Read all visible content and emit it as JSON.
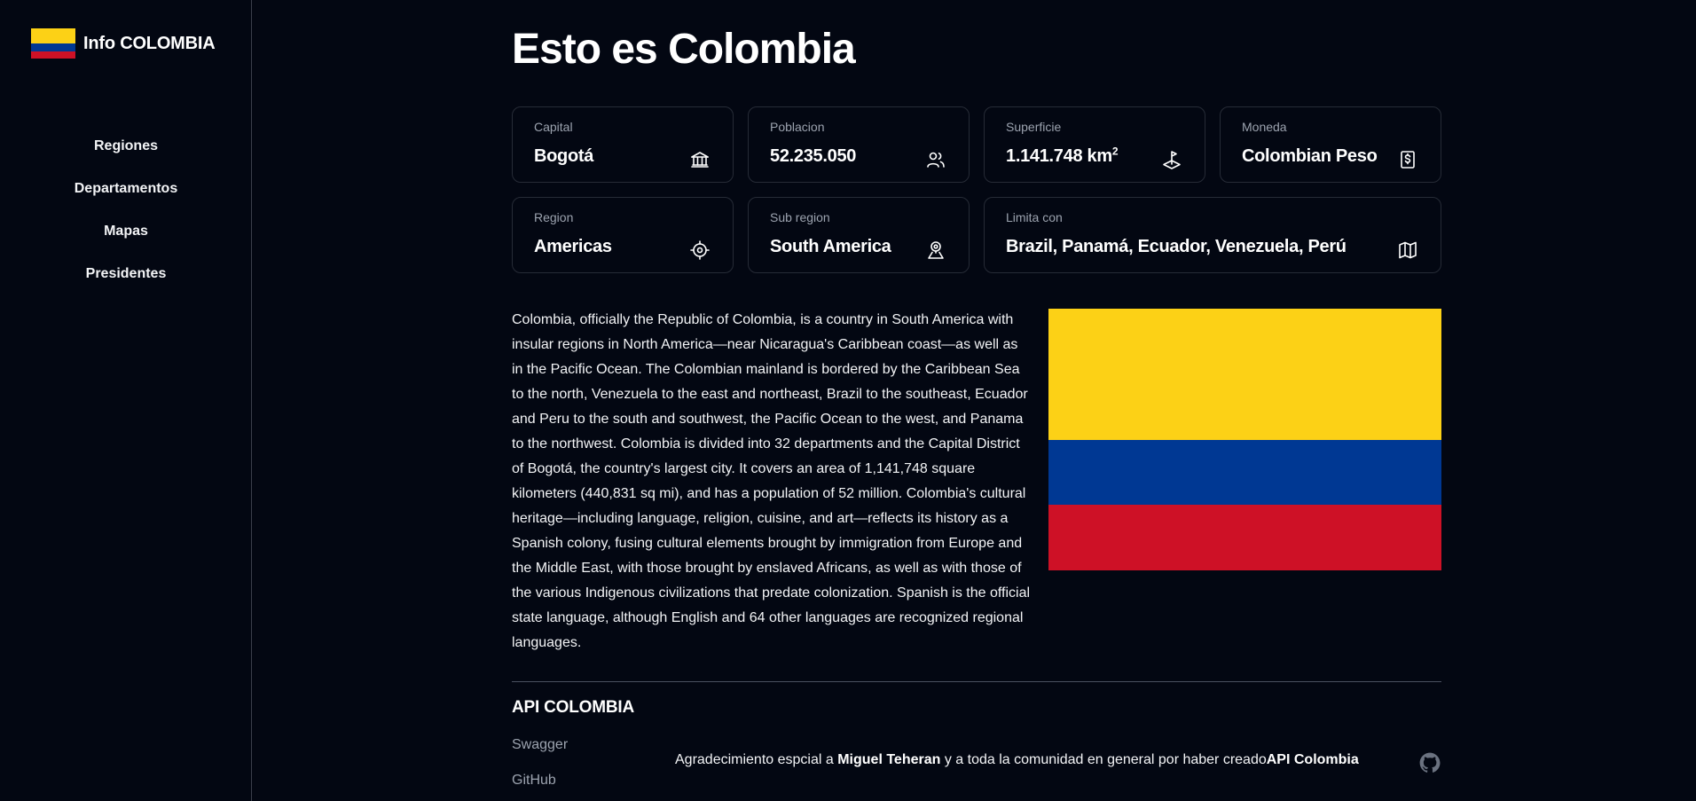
{
  "app": {
    "title": "Info COLOMBIA",
    "flag_colors": [
      "#FCD116",
      "#003893",
      "#CE1126"
    ]
  },
  "sidebar": {
    "items": [
      {
        "label": "Regiones"
      },
      {
        "label": "Departamentos"
      },
      {
        "label": "Mapas"
      },
      {
        "label": "Presidentes"
      }
    ]
  },
  "main": {
    "title": "Esto es Colombia",
    "cards": [
      {
        "label": "Capital",
        "value": "Bogotá",
        "icon": "bank-icon"
      },
      {
        "label": "Poblacion",
        "value": "52.235.050",
        "icon": "users-icon"
      },
      {
        "label": "Superficie",
        "value": "1.141.748 km",
        "value_sup": "2",
        "icon": "area-icon"
      },
      {
        "label": "Moneda",
        "value": "Colombian Peso",
        "icon": "dollar-receipt-icon"
      },
      {
        "label": "Region",
        "value": "Americas",
        "icon": "target-icon"
      },
      {
        "label": "Sub region",
        "value": "South America",
        "icon": "map-pin-icon"
      },
      {
        "label": "Limita con",
        "value": "Brazil, Panamá, Ecuador, Venezuela, Perú",
        "icon": "map-icon"
      }
    ],
    "description": "Colombia, officially the Republic of Colombia, is a country in South America with insular regions in North America—near Nicaragua's Caribbean coast—as well as in the Pacific Ocean. The Colombian mainland is bordered by the Caribbean Sea to the north, Venezuela to the east and northeast, Brazil to the southeast, Ecuador and Peru to the south and southwest, the Pacific Ocean to the west, and Panama to the northwest. Colombia is divided into 32 departments and the Capital District of Bogotá, the country's largest city. It covers an area of 1,141,748 square kilometers (440,831 sq mi), and has a population of 52 million. Colombia's cultural heritage—including language, religion, cuisine, and art—reflects its history as a Spanish colony, fusing cultural elements brought by immigration from Europe and the Middle East, with those brought by enslaved Africans, as well as with those of the various Indigenous civilizations that predate colonization. Spanish is the official state language, although English and 64 other languages are recognized regional languages."
  },
  "footer": {
    "title": "API COLOMBIA",
    "links": [
      {
        "label": "Swagger"
      },
      {
        "label": "GitHub"
      }
    ],
    "credits_prefix": "Agradecimiento espcial a ",
    "credits_name": "Miguel Teheran",
    "credits_middle": " y a toda la comunidad en general por haber creado",
    "credits_project": "API Colombia",
    "github_icon": "github-icon"
  }
}
